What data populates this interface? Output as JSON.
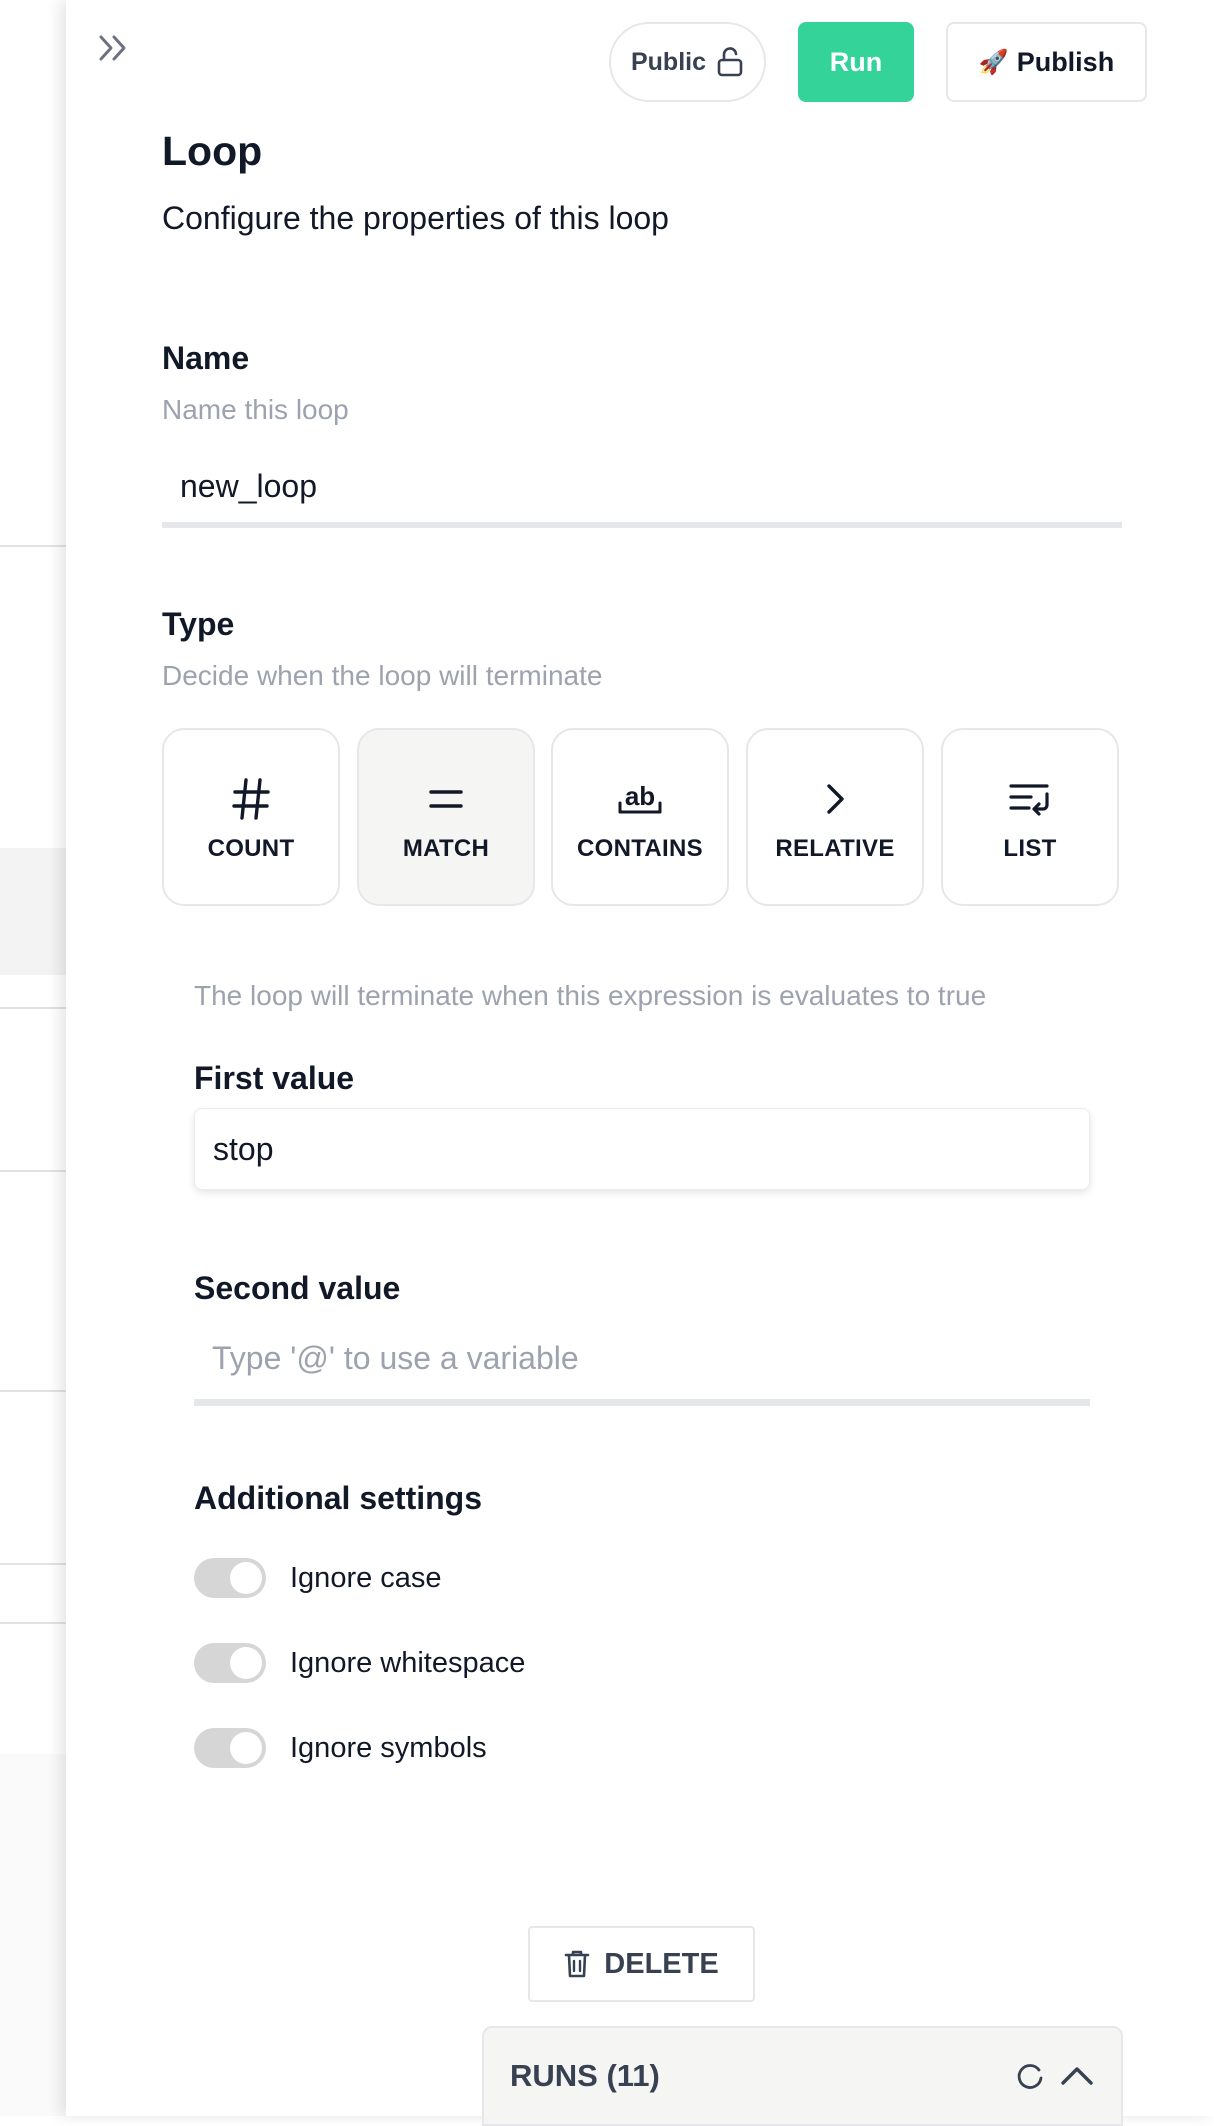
{
  "header": {
    "visibility_label": "Public",
    "run_label": "Run",
    "publish_label": "Publish",
    "publish_emoji": "🚀"
  },
  "loop": {
    "title": "Loop",
    "subtitle": "Configure the properties of this loop"
  },
  "name_section": {
    "label": "Name",
    "hint": "Name this loop",
    "value": "new_loop"
  },
  "type_section": {
    "label": "Type",
    "hint": "Decide when the loop will terminate",
    "selected": "MATCH",
    "options": [
      {
        "label": "COUNT",
        "icon": "hash-icon"
      },
      {
        "label": "MATCH",
        "icon": "equals-icon"
      },
      {
        "label": "CONTAINS",
        "icon": "text-ab-icon"
      },
      {
        "label": "RELATIVE",
        "icon": "chevron-right-icon"
      },
      {
        "label": "LIST",
        "icon": "list-wrap-icon"
      }
    ]
  },
  "match": {
    "description": "The loop will terminate when this expression is evaluates to true",
    "first_value_label": "First value",
    "first_value": "stop",
    "second_value_label": "Second value",
    "second_value_placeholder": "Type '@' to use a variable"
  },
  "additional_settings": {
    "label": "Additional settings",
    "toggles": [
      {
        "label": "Ignore case",
        "on": true
      },
      {
        "label": "Ignore whitespace",
        "on": true
      },
      {
        "label": "Ignore symbols",
        "on": true
      }
    ]
  },
  "actions": {
    "delete_label": "DELETE"
  },
  "runs": {
    "label": "RUNS (11)"
  }
}
